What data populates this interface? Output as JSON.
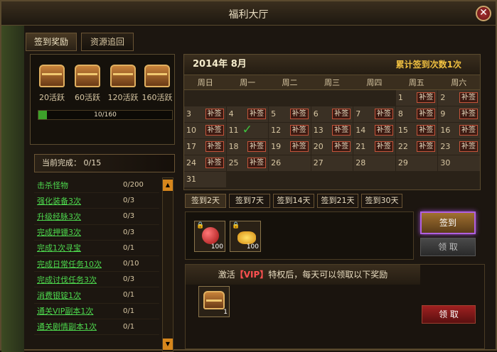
{
  "window": {
    "title": "福利大厅",
    "close": "✕"
  },
  "tabs": [
    {
      "label": "签到奖励"
    },
    {
      "label": "资源追回"
    }
  ],
  "chests": [
    {
      "label": "20活跃"
    },
    {
      "label": "60活跃"
    },
    {
      "label": "120活跃"
    },
    {
      "label": "160活跃"
    }
  ],
  "progress": {
    "text": "10/160",
    "fraction": 0.0625
  },
  "tasks": {
    "header": "当前完成：  0/15",
    "items": [
      {
        "name": "击杀怪物",
        "value": "0/200"
      },
      {
        "name": "强化装备3次",
        "value": "0/3"
      },
      {
        "name": "升级经脉3次",
        "value": "0/3"
      },
      {
        "name": "完成押镖3次",
        "value": "0/3"
      },
      {
        "name": "完成1次寻宝",
        "value": "0/1"
      },
      {
        "name": "完成日常任务10次",
        "value": "0/10"
      },
      {
        "name": "完成讨伐任务3次",
        "value": "0/3"
      },
      {
        "name": "消费银锭1次",
        "value": "0/1"
      },
      {
        "name": "通关VIP副本1次",
        "value": "0/1"
      },
      {
        "name": "通关剧情副本1次",
        "value": "0/1"
      }
    ]
  },
  "calendar": {
    "month": "2014年  8月",
    "sign_count": "累计签到次数1次",
    "weekdays": [
      "周日",
      "周一",
      "周二",
      "周三",
      "周四",
      "周五",
      "周六"
    ],
    "badge_label": "补签",
    "check": "✓",
    "cells": [
      {
        "d": ""
      },
      {
        "d": ""
      },
      {
        "d": ""
      },
      {
        "d": ""
      },
      {
        "d": ""
      },
      {
        "d": "1",
        "b": 1
      },
      {
        "d": "2",
        "b": 1
      },
      {
        "d": "3",
        "b": 1
      },
      {
        "d": "4",
        "b": 1
      },
      {
        "d": "5",
        "b": 1
      },
      {
        "d": "6",
        "b": 1
      },
      {
        "d": "7",
        "b": 1
      },
      {
        "d": "8",
        "b": 1
      },
      {
        "d": "9",
        "b": 1
      },
      {
        "d": "10",
        "b": 1
      },
      {
        "d": "11",
        "c": 1
      },
      {
        "d": "12",
        "b": 1
      },
      {
        "d": "13",
        "b": 1
      },
      {
        "d": "14",
        "b": 1
      },
      {
        "d": "15",
        "b": 1
      },
      {
        "d": "16",
        "b": 1
      },
      {
        "d": "17",
        "b": 1
      },
      {
        "d": "18",
        "b": 1
      },
      {
        "d": "19",
        "b": 1
      },
      {
        "d": "20",
        "b": 1
      },
      {
        "d": "21",
        "b": 1
      },
      {
        "d": "22",
        "b": 1
      },
      {
        "d": "23",
        "b": 1
      },
      {
        "d": "24",
        "b": 1
      },
      {
        "d": "25",
        "b": 1
      },
      {
        "d": "26"
      },
      {
        "d": "27"
      },
      {
        "d": "28"
      },
      {
        "d": "29"
      },
      {
        "d": "30"
      },
      {
        "d": "31"
      },
      {
        "d": ""
      },
      {
        "d": ""
      },
      {
        "d": ""
      },
      {
        "d": ""
      },
      {
        "d": ""
      },
      {
        "d": ""
      }
    ]
  },
  "day_tabs": [
    {
      "label": "签到2天"
    },
    {
      "label": "签到7天"
    },
    {
      "label": "签到14天"
    },
    {
      "label": "签到21天"
    },
    {
      "label": "签到30天"
    }
  ],
  "rewards": [
    {
      "qty": "100"
    },
    {
      "qty": "100"
    }
  ],
  "buttons": {
    "sign": "签到",
    "claim": "领 取",
    "claim2": "领 取"
  },
  "vip": {
    "prefix": "激活",
    "tag": "【VIP】",
    "suffix": "特权后，每天可以领取以下奖励",
    "item_qty": "1"
  }
}
